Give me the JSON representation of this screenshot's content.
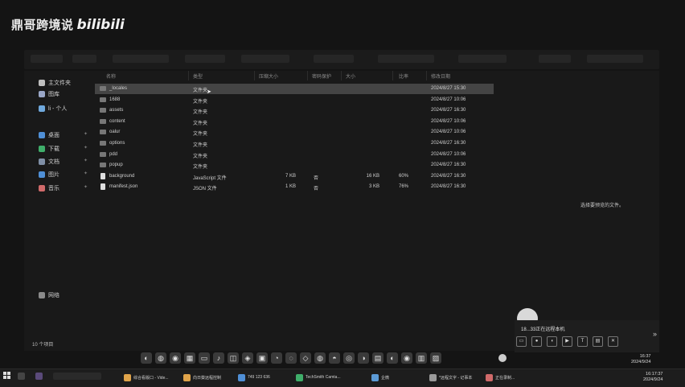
{
  "watermark": {
    "text": "鼎哥跨境说",
    "logo": "bilibili"
  },
  "sidebar": {
    "items": [
      {
        "label": "主文件夹",
        "icon": "home-icon",
        "color": "#bfbfbf"
      },
      {
        "label": "图库",
        "icon": "gallery-icon",
        "color": "#9aa7c7"
      },
      {
        "label": "li - 个人",
        "icon": "cloud-icon",
        "color": "#6fa8dc"
      },
      {
        "label": "桌面",
        "icon": "desktop-icon",
        "color": "#4f8fd6"
      },
      {
        "label": "下载",
        "icon": "download-icon",
        "color": "#3fae6a"
      },
      {
        "label": "文档",
        "icon": "document-icon",
        "color": "#7f8fa6"
      },
      {
        "label": "图片",
        "icon": "picture-icon",
        "color": "#4f8fd6"
      },
      {
        "label": "音乐",
        "icon": "music-icon",
        "color": "#d06a6a"
      },
      {
        "label": "网络",
        "icon": "network-icon",
        "color": "#8a8a8a"
      }
    ]
  },
  "columns": {
    "name": "名称",
    "type": "类型",
    "compressed": "压缩大小",
    "password": "密码保护",
    "size": "大小",
    "ratio": "比率",
    "modified": "修改日期"
  },
  "files": [
    {
      "name": "_locales",
      "type": "文件夹",
      "compressed": "",
      "password": "",
      "size": "",
      "ratio": "",
      "modified": "2024/8/27 15:30",
      "kind": "folder"
    },
    {
      "name": "1688",
      "type": "文件夹",
      "compressed": "",
      "password": "",
      "size": "",
      "ratio": "",
      "modified": "2024/8/27 10:06",
      "kind": "folder"
    },
    {
      "name": "assets",
      "type": "文件夹",
      "compressed": "",
      "password": "",
      "size": "",
      "ratio": "",
      "modified": "2024/8/27 16:30",
      "kind": "folder"
    },
    {
      "name": "content",
      "type": "文件夹",
      "compressed": "",
      "password": "",
      "size": "",
      "ratio": "",
      "modified": "2024/8/27 10:06",
      "kind": "folder"
    },
    {
      "name": "oalur",
      "type": "文件夹",
      "compressed": "",
      "password": "",
      "size": "",
      "ratio": "",
      "modified": "2024/8/27 10:06",
      "kind": "folder"
    },
    {
      "name": "options",
      "type": "文件夹",
      "compressed": "",
      "password": "",
      "size": "",
      "ratio": "",
      "modified": "2024/8/27 16:30",
      "kind": "folder"
    },
    {
      "name": "pdd",
      "type": "文件夹",
      "compressed": "",
      "password": "",
      "size": "",
      "ratio": "",
      "modified": "2024/8/27 10:06",
      "kind": "folder"
    },
    {
      "name": "popup",
      "type": "文件夹",
      "compressed": "",
      "password": "",
      "size": "",
      "ratio": "",
      "modified": "2024/8/27 16:30",
      "kind": "folder"
    },
    {
      "name": "background",
      "type": "JavaScript 文件",
      "compressed": "7 KB",
      "password": "否",
      "size": "16 KB",
      "ratio": "60%",
      "modified": "2024/8/27 16:30",
      "kind": "file"
    },
    {
      "name": "manifest.json",
      "type": "JSON 文件",
      "compressed": "1 KB",
      "password": "否",
      "size": "3 KB",
      "ratio": "76%",
      "modified": "2024/8/27 16:30",
      "kind": "file"
    }
  ],
  "preview_message": "选择要预览的文件。",
  "status": {
    "item_count": "10 个项目"
  },
  "notification": {
    "text": "18...33正在远程本机",
    "buttons": [
      "msg",
      "mic",
      "vol",
      "video",
      "T",
      "folder",
      "close"
    ]
  },
  "clock": {
    "time": "16:37",
    "date": "2024/9/24"
  },
  "taskbar_clock": {
    "time": "16:17:37",
    "date": "2024/9/24"
  },
  "taskbar": {
    "items": [
      {
        "label": "综合看版口 - Vide...",
        "color": "#e0a44a"
      },
      {
        "label": "向日葵远程控制",
        "color": "#e0a44a"
      },
      {
        "label": "749 123 636",
        "color": "#4f8fd6"
      },
      {
        "label": "TechSmith Camta...",
        "color": "#3fae6a"
      },
      {
        "label": "企微",
        "color": "#5c9bd6"
      },
      {
        "label": "*远程文字 - 记事本",
        "color": "#9a9a9a"
      },
      {
        "label": "正在录制...",
        "color": "#d06a6a"
      }
    ]
  },
  "dock": {
    "icons": [
      "◐",
      "◍",
      "◉",
      "▦",
      "▭",
      "♪",
      "◫",
      "◈",
      "▣",
      "◔",
      "◌",
      "◇",
      "◍",
      "◓",
      "◎",
      "◑",
      "▤",
      "◐",
      "◉",
      "▥",
      "▨"
    ]
  }
}
